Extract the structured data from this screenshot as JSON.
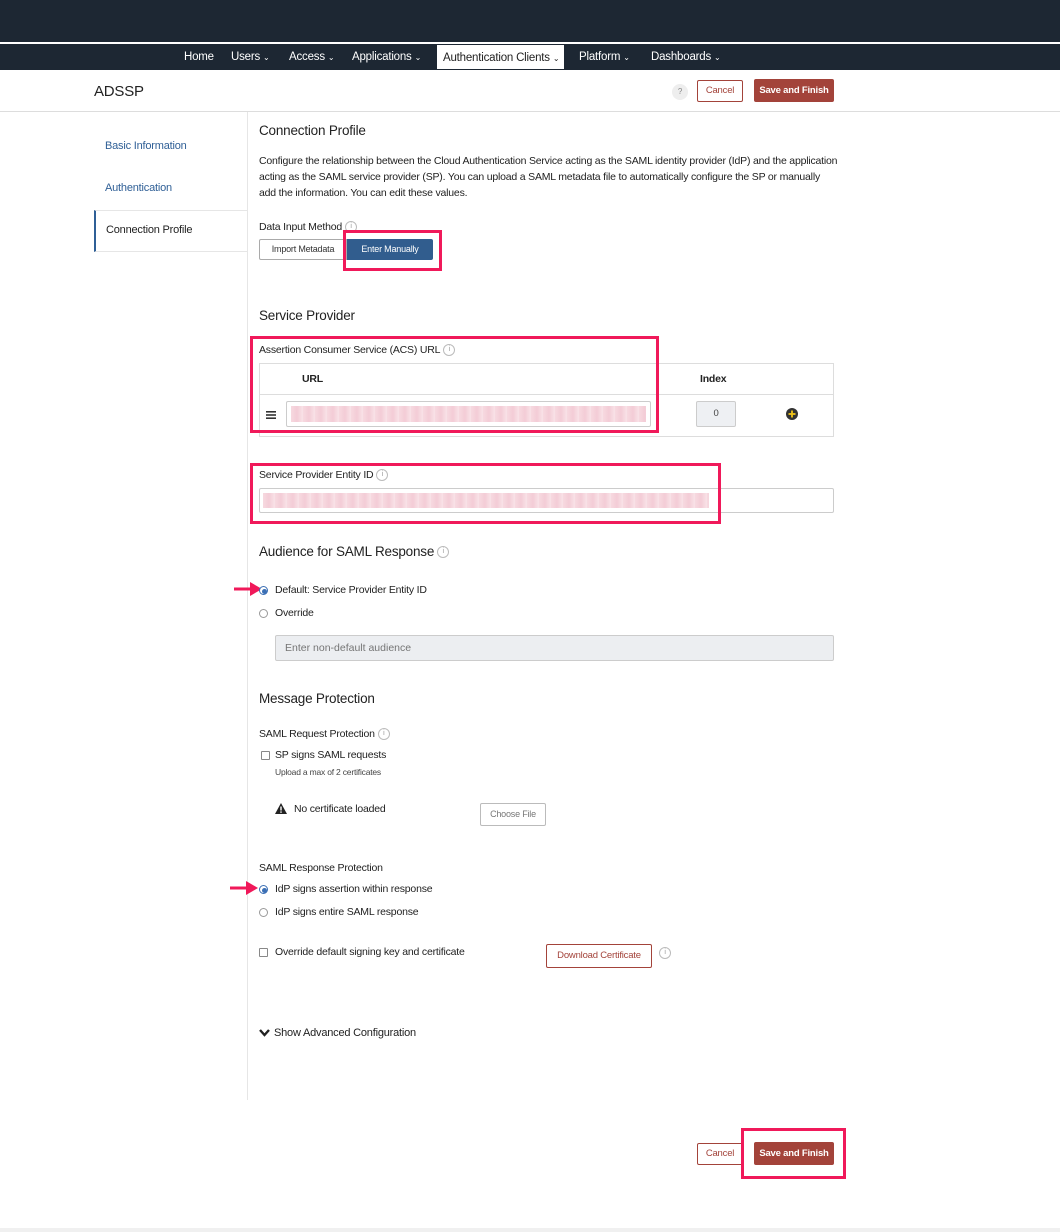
{
  "nav": {
    "items": [
      {
        "label": "Home",
        "caret": ""
      },
      {
        "label": "Users",
        "caret": "⌄"
      },
      {
        "label": "Access",
        "caret": "⌄"
      },
      {
        "label": "Applications",
        "caret": "⌄"
      },
      {
        "label": "Authentication Clients",
        "caret": "⌄"
      },
      {
        "label": "Platform",
        "caret": "⌄"
      },
      {
        "label": "Dashboards",
        "caret": "⌄"
      }
    ]
  },
  "header": {
    "title": "ADSSP",
    "help": "?",
    "cancel_label": "Cancel",
    "save_label": "Save and Finish"
  },
  "sidebar": {
    "items": [
      {
        "label": "Basic Information"
      },
      {
        "label": "Authentication"
      },
      {
        "label": "Connection Profile"
      }
    ]
  },
  "connection_profile": {
    "title": "Connection Profile",
    "description": "Configure the relationship between the Cloud Authentication Service acting as the SAML identity provider (IdP) and the application acting as the SAML service provider (SP). You can upload a SAML metadata file to automatically configure the SP or manually add the information. You can edit these values.",
    "input_method_label": "Data Input Method",
    "import_metadata_label": "Import Metadata",
    "enter_manually_label": "Enter Manually"
  },
  "service_provider": {
    "title": "Service Provider",
    "acs_label": "Assertion Consumer Service (ACS) URL",
    "col_url": "URL",
    "col_index": "Index",
    "index_value": "0",
    "entity_id_label": "Service Provider Entity ID"
  },
  "audience": {
    "title": "Audience for SAML Response",
    "default_label": "Default: Service Provider Entity ID",
    "override_label": "Override",
    "placeholder": "Enter non-default audience"
  },
  "message_protection": {
    "title": "Message Protection",
    "request_label": "SAML Request Protection",
    "sp_signs_label": "SP signs SAML requests",
    "upload_hint": "Upload a max of 2 certificates",
    "no_cert_label": "No certificate loaded",
    "choose_file_label": "Choose File",
    "response_label": "SAML Response Protection",
    "idp_assertion_label": "IdP signs assertion within response",
    "idp_entire_label": "IdP signs entire SAML response",
    "override_key_label": "Override default signing key and certificate",
    "download_cert_label": "Download Certificate"
  },
  "advanced": {
    "label": "Show Advanced Configuration"
  },
  "footer": {
    "cancel_label": "Cancel",
    "save_label": "Save and Finish"
  },
  "colors": {
    "nav_bg": "#1d2733",
    "accent_red": "#a3433a",
    "accent_blue": "#315d8e",
    "highlight": "#f0195a"
  }
}
